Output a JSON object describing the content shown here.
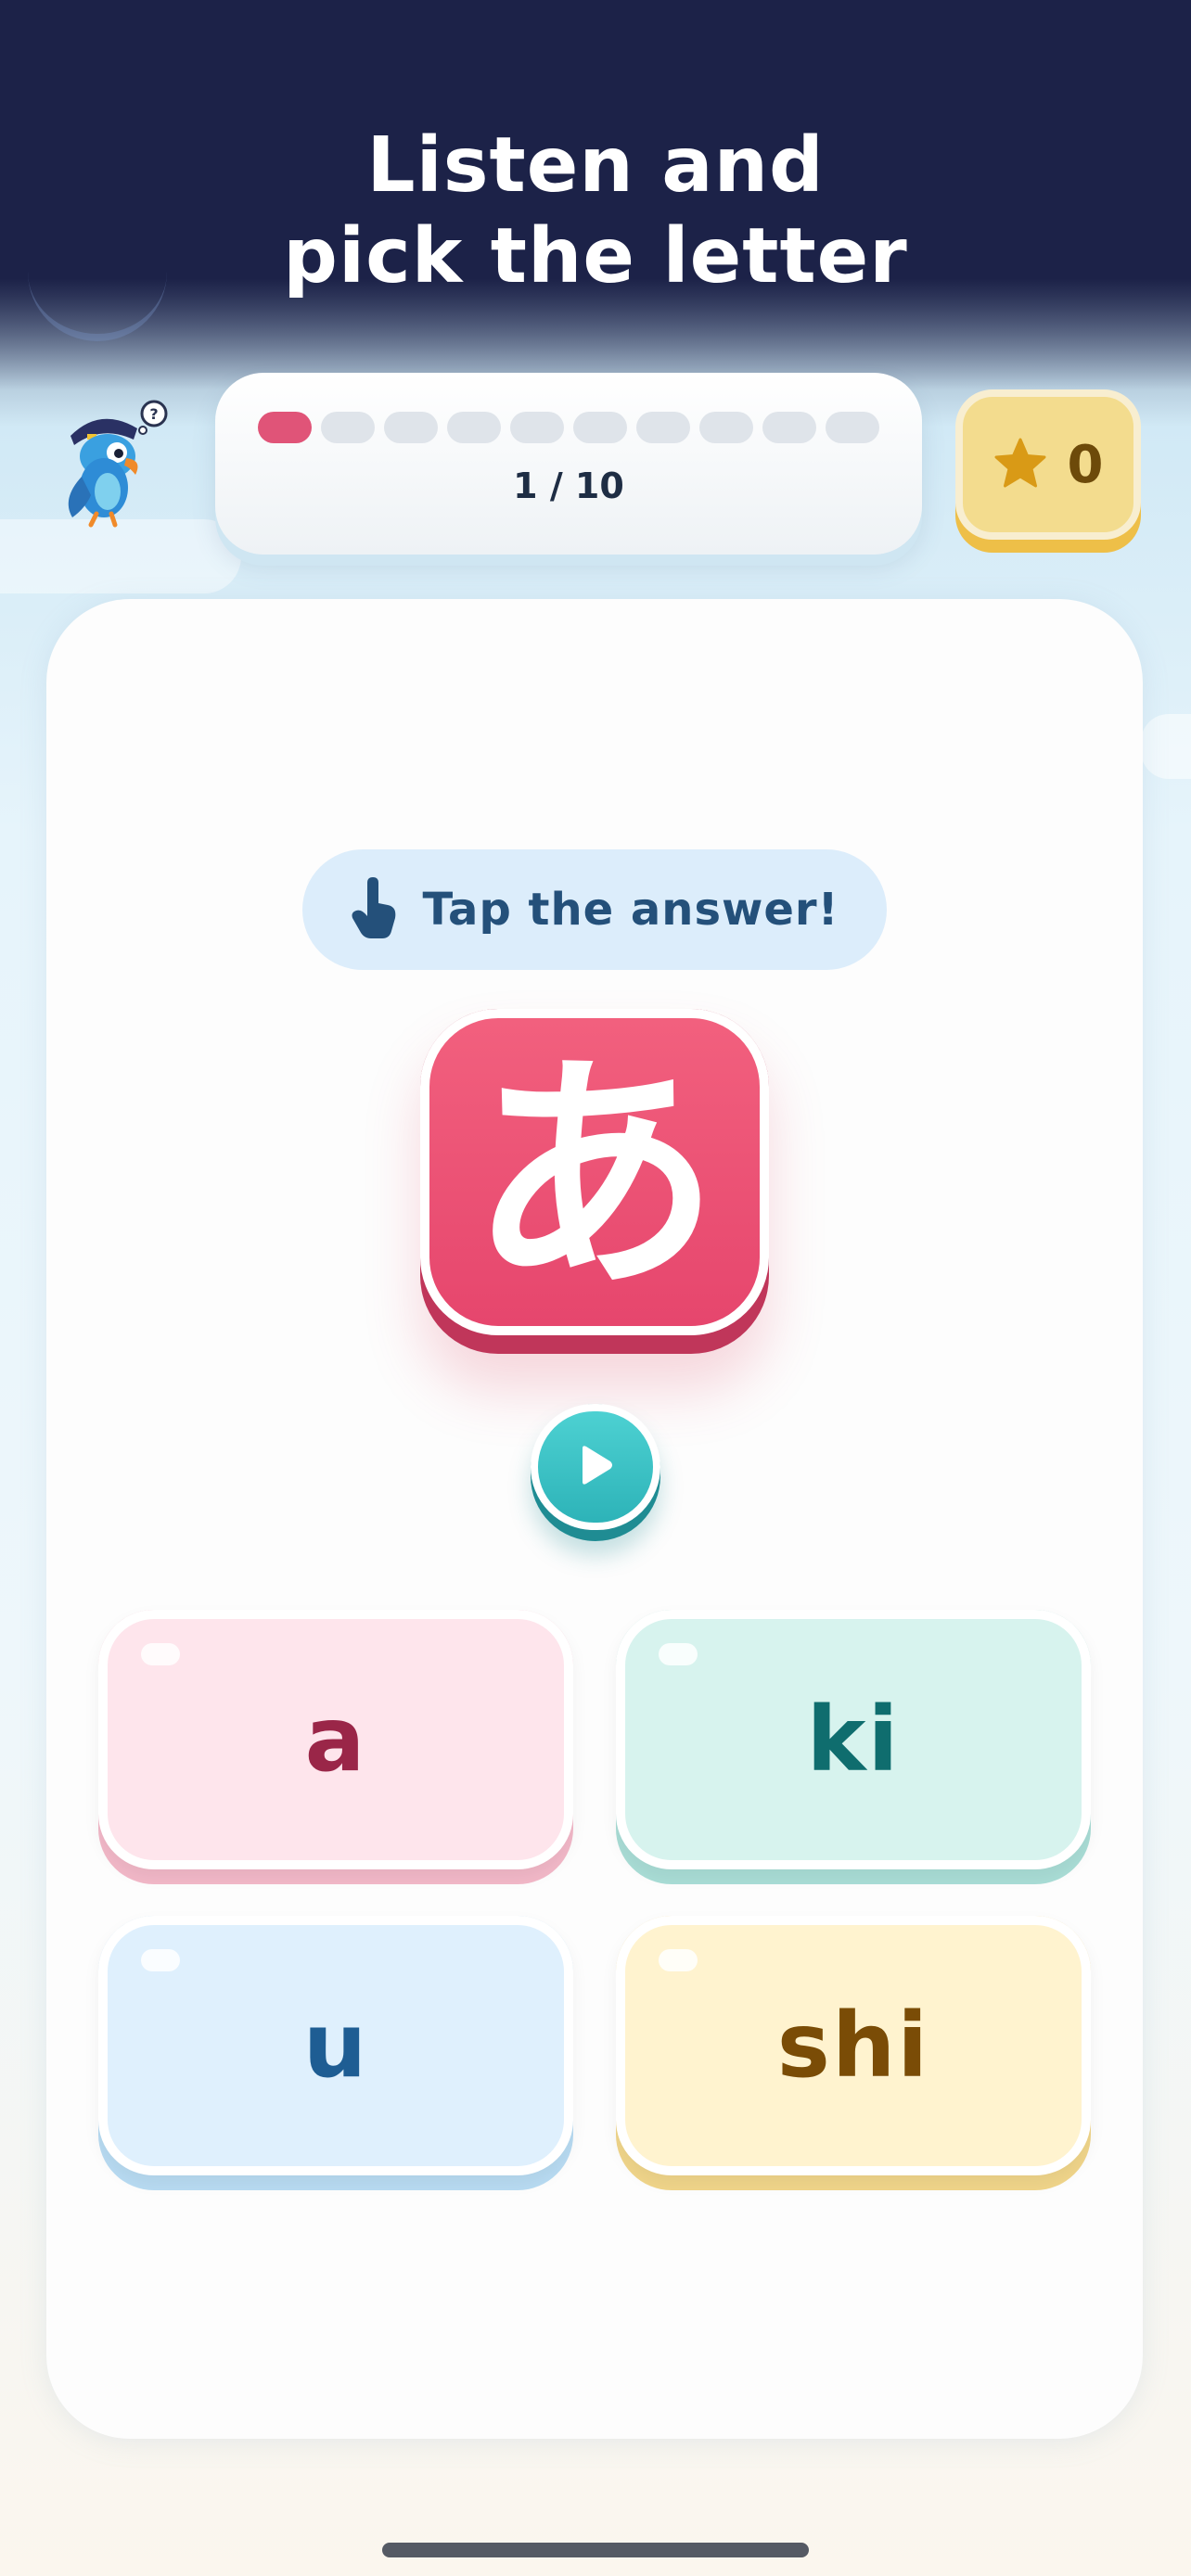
{
  "header": {
    "title_line1": "Listen and",
    "title_line2": "pick the letter"
  },
  "mascot": {
    "icon": "pirate-parrot-icon",
    "thought": "?"
  },
  "progress": {
    "total_segments": 10,
    "current": 1,
    "label": "1 / 10",
    "active_color": "#e05478",
    "inactive_color": "#dfe4ea"
  },
  "score": {
    "icon": "star-icon",
    "value": "0",
    "star_color": "#d99a16"
  },
  "instruction": {
    "icon": "tap-hand-icon",
    "text": "Tap the answer!"
  },
  "prompt": {
    "character": "あ",
    "tile_color": "#e6466d"
  },
  "audio": {
    "icon": "play-icon"
  },
  "answers": [
    {
      "label": "a"
    },
    {
      "label": "ki"
    },
    {
      "label": "u"
    },
    {
      "label": "shi"
    }
  ]
}
